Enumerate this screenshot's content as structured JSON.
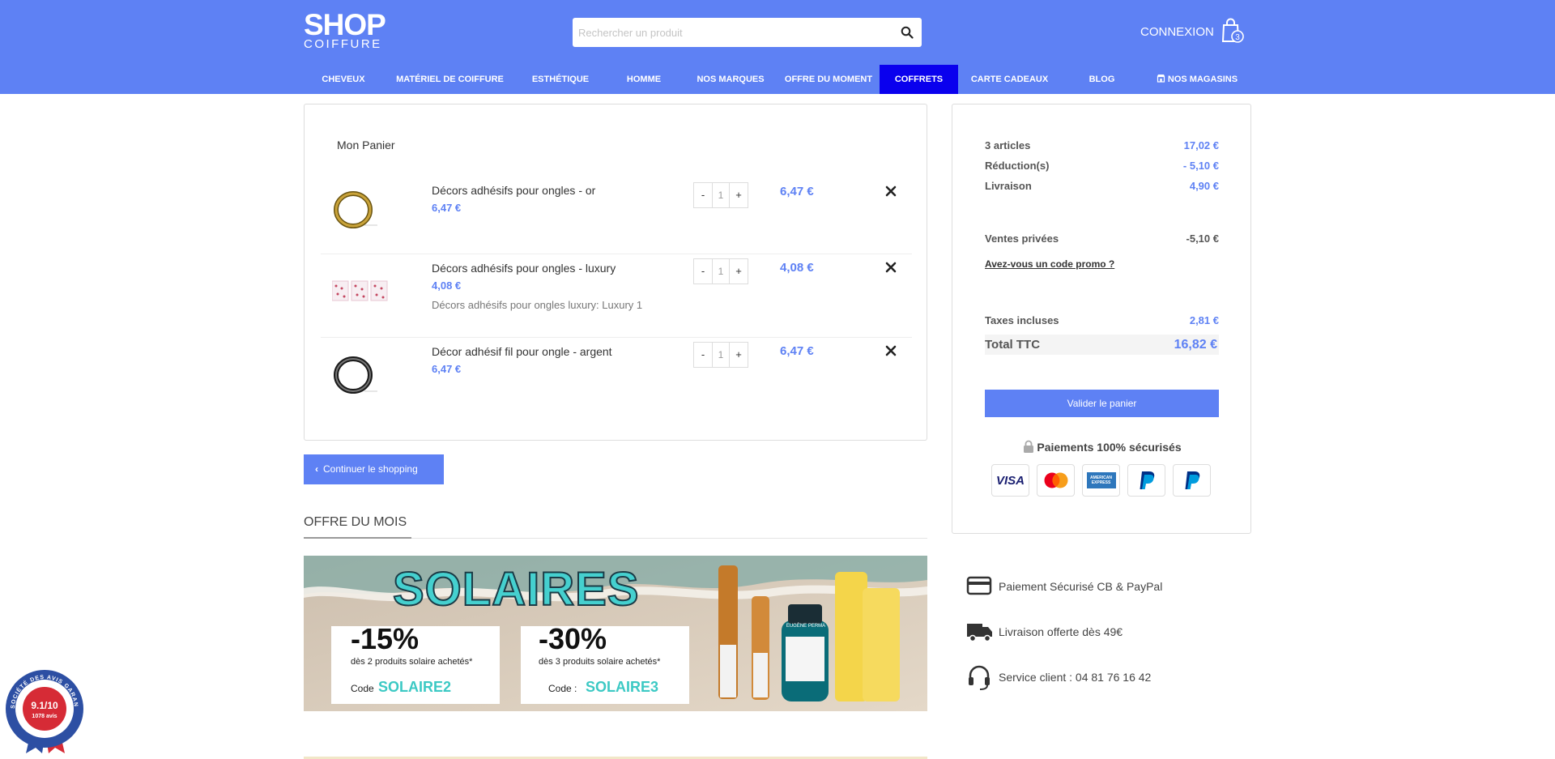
{
  "header": {
    "logo_top": "SHOP",
    "logo_bottom": "COIFFURE",
    "search_placeholder": "Rechercher un produit",
    "connexion": "CONNEXION",
    "cart_count": "3"
  },
  "nav": [
    {
      "label": "CHEVEUX",
      "active": false
    },
    {
      "label": "MATÉRIEL DE COIFFURE",
      "active": false
    },
    {
      "label": "ESTHÉTIQUE",
      "active": false
    },
    {
      "label": "HOMME",
      "active": false
    },
    {
      "label": "NOS MARQUES",
      "active": false
    },
    {
      "label": "OFFRE DU MOMENT",
      "active": false
    },
    {
      "label": "COFFRETS",
      "active": true
    },
    {
      "label": "CARTE CADEAUX",
      "active": false
    },
    {
      "label": "BLOG",
      "active": false
    },
    {
      "label": "NOS MAGASINS",
      "active": false
    }
  ],
  "cart": {
    "title": "Mon Panier",
    "items": [
      {
        "name": "Décors adhésifs pour ongles - or",
        "unit_price": "6,47 €",
        "variant": "",
        "qty": "1",
        "line_total": "6,47 €"
      },
      {
        "name": "Décors adhésifs pour ongles - luxury",
        "unit_price": "4,08 €",
        "variant": "Décors adhésifs pour ongles luxury: Luxury 1",
        "qty": "1",
        "line_total": "4,08 €"
      },
      {
        "name": "Décor adhésif fil pour ongle - argent",
        "unit_price": "6,47 €",
        "variant": "",
        "qty": "1",
        "line_total": "6,47 €"
      }
    ],
    "minus": "-",
    "plus": "+",
    "continue": "Continuer le shopping"
  },
  "offre": {
    "title": "OFFRE DU MOIS",
    "banner": {
      "headline": "SOLAIRES",
      "promo1_pct": "-15%",
      "promo1_desc": "dès 2 produits solaire achetés*",
      "promo1_code_label": "Code",
      "promo1_code": "SOLAIRE2",
      "promo2_pct": "-30%",
      "promo2_desc": "dès 3 produits solaire achetés*",
      "promo2_code_label": "Code :",
      "promo2_code": "SOLAIRE3",
      "brand": "EUGÈNE PERMA"
    }
  },
  "summary": {
    "rows": [
      {
        "label": "3 articles",
        "value": "17,02 €"
      },
      {
        "label": "Réduction(s)",
        "value": "- 5,10 €"
      },
      {
        "label": "Livraison",
        "value": "4,90 €"
      }
    ],
    "ventes_label": "Ventes privées",
    "ventes_value": "-5,10 €",
    "promo_link": "Avez-vous un code promo ?",
    "taxes_label": "Taxes incluses",
    "taxes_value": "2,81 €",
    "total_label": "Total TTC",
    "total_value": "16,82 €",
    "validate": "Valider le panier",
    "secure": "Paiements 100% sécurisés",
    "cards": [
      "VISA",
      "Mastercard",
      "AMERICAN EXPRESS",
      "PayPal",
      "PayPal"
    ]
  },
  "features": [
    {
      "icon": "credit-card-icon",
      "label": "Paiement Sécurisé CB & PayPal"
    },
    {
      "icon": "truck-icon",
      "label": "Livraison offerte dès 49€"
    },
    {
      "icon": "headset-icon",
      "label": "Service client : 04 81 76 16 42"
    }
  ],
  "badge": {
    "score": "9.1/10",
    "reviews": "1078 avis",
    "ring_text": "SOCIÉTÉ DES AVIS GARANTIS"
  },
  "colors": {
    "brand": "#5e81f4",
    "nav_active": "#0a00ee"
  }
}
